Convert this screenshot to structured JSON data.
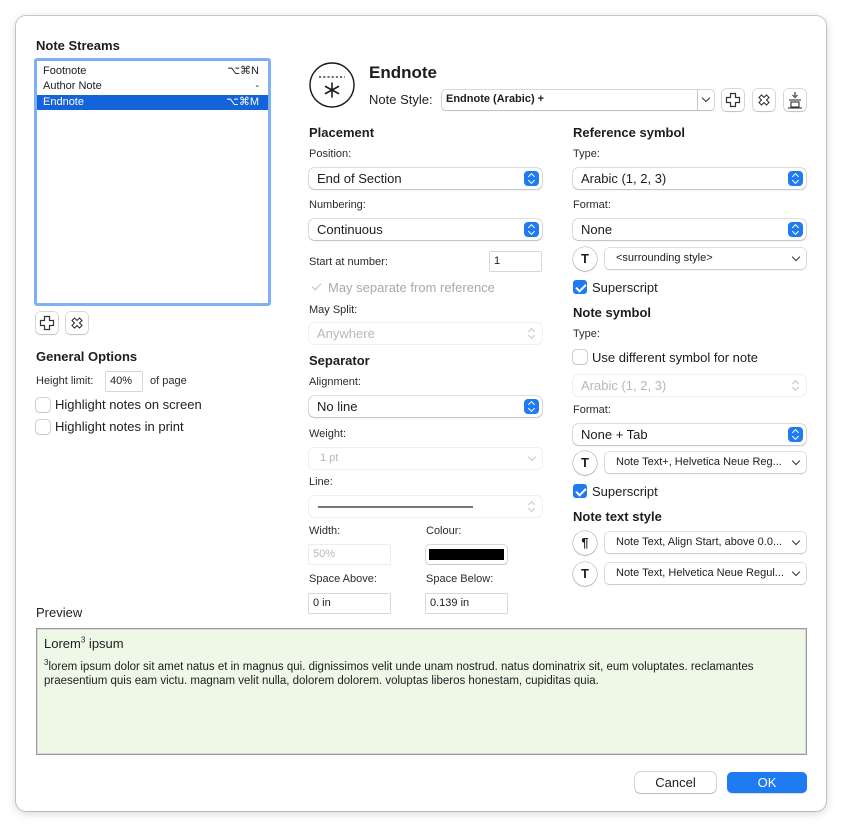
{
  "note_streams": {
    "title": "Note Streams",
    "items": [
      {
        "label": "Footnote",
        "shortcut": "⌥⌘N"
      },
      {
        "label": "Author Note",
        "shortcut": "-"
      },
      {
        "label": "Endnote",
        "shortcut": "⌥⌘M"
      }
    ],
    "selected_index": 2
  },
  "general_options": {
    "title": "General Options",
    "height_limit_label": "Height limit:",
    "height_limit_value": "40%",
    "height_limit_suffix": "of page",
    "highlight_screen_label": "Highlight notes on screen",
    "highlight_screen_checked": false,
    "highlight_print_label": "Highlight notes in print",
    "highlight_print_checked": false
  },
  "header": {
    "stream_name": "Endnote",
    "note_style_label": "Note Style:",
    "note_style_value": "Endnote (Arabic) +"
  },
  "placement": {
    "title": "Placement",
    "position_label": "Position:",
    "position_value": "End of Section",
    "numbering_label": "Numbering:",
    "numbering_value": "Continuous",
    "start_at_label": "Start at number:",
    "start_at_value": "1",
    "may_separate_label": "May separate from reference",
    "may_split_label": "May Split:",
    "may_split_value": "Anywhere"
  },
  "separator": {
    "title": "Separator",
    "alignment_label": "Alignment:",
    "alignment_value": "No line",
    "weight_label": "Weight:",
    "weight_value": "1 pt",
    "line_label": "Line:",
    "width_label": "Width:",
    "width_value": "50%",
    "colour_label": "Colour:",
    "colour_value": "#000000",
    "space_above_label": "Space Above:",
    "space_above_value": "0 in",
    "space_below_label": "Space Below:",
    "space_below_value": "0.139 in"
  },
  "reference_symbol": {
    "title": "Reference symbol",
    "type_label": "Type:",
    "type_value": "Arabic (1, 2, 3)",
    "format_label": "Format:",
    "format_value": "None",
    "style_value": "<surrounding style>",
    "superscript_label": "Superscript",
    "superscript_checked": true
  },
  "note_symbol": {
    "title": "Note symbol",
    "type_label": "Type:",
    "use_different_label": "Use different symbol for note",
    "use_different_checked": false,
    "type_value": "Arabic (1, 2, 3)",
    "format_label": "Format:",
    "format_value": "None + Tab",
    "style_value": "Note Text+, Helvetica Neue Reg...",
    "superscript_label": "Superscript",
    "superscript_checked": true
  },
  "note_text_style": {
    "title": "Note text style",
    "paragraph_style_value": "Note Text, Align Start, above 0.0...",
    "character_style_value": "Note Text, Helvetica Neue Regul..."
  },
  "preview": {
    "title": "Preview",
    "heading_text": "Lorem",
    "heading_sup": "3",
    "heading_after": " ipsum",
    "note_sup": "3",
    "note_text": "lorem ipsum dolor sit amet natus et in magnus qui. dignissimos velit unde unam nostrud. natus dominatrix sit, eum voluptates. reclamantes praesentium quis eam victu. magnam velit nulla, dolorem dolorem. voluptas liberos honestam, cupiditas quia."
  },
  "buttons": {
    "cancel": "Cancel",
    "ok": "OK"
  },
  "icons": {
    "add": "plus-icon",
    "remove": "remove-icon",
    "insert": "insert-icon",
    "character_style": "T",
    "paragraph_style": "¶"
  },
  "colors": {
    "accent": "#1f7bf2",
    "selection": "#1463d8",
    "preview_background": "#eef8e6"
  }
}
